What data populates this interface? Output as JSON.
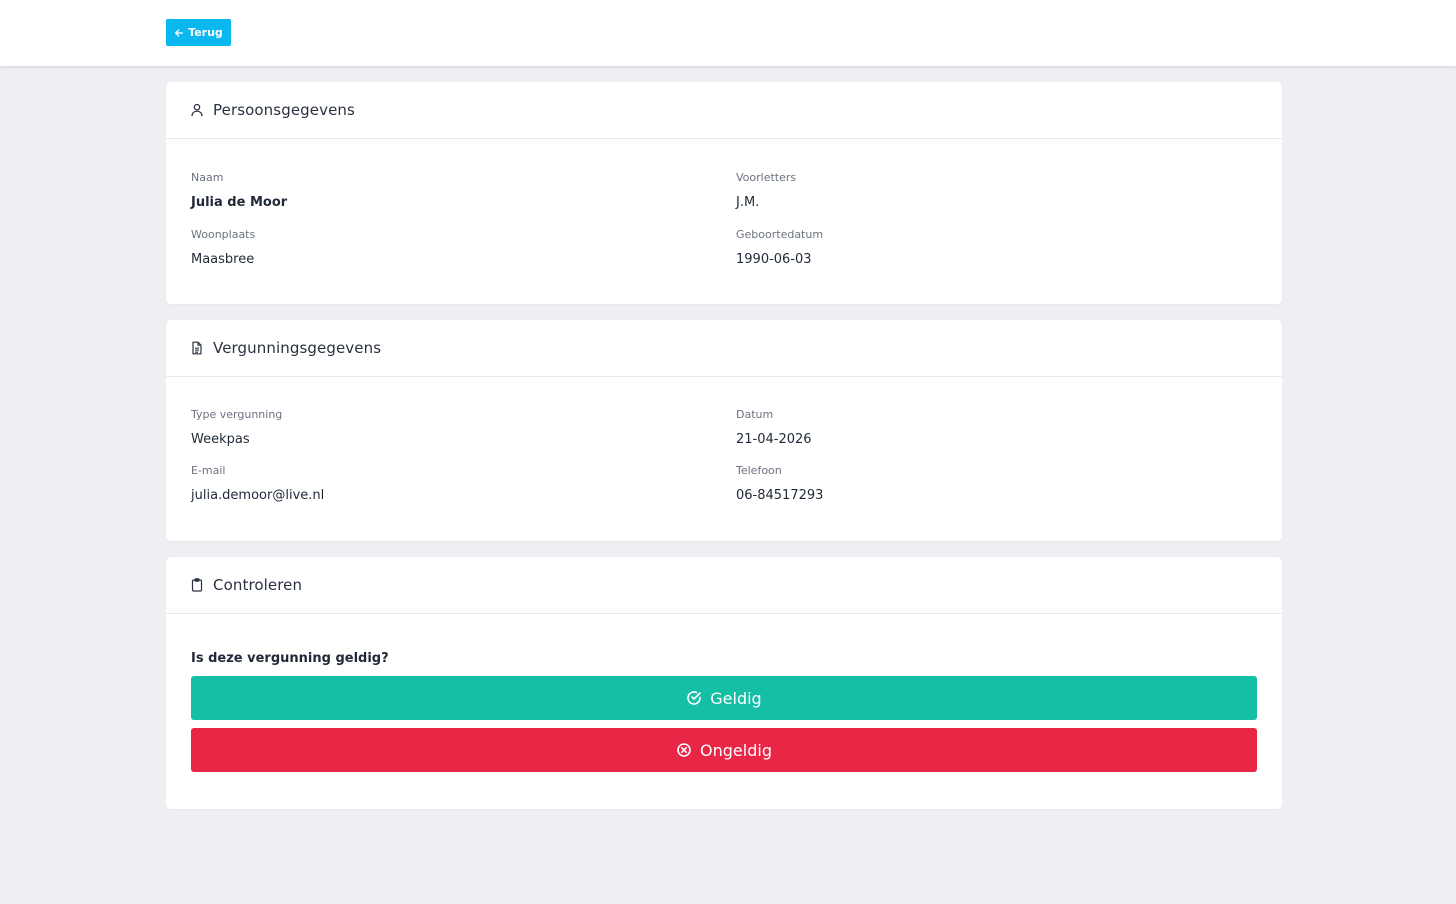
{
  "header": {
    "back_label": "Terug"
  },
  "person": {
    "title": "Persoonsgegevens",
    "name_label": "Naam",
    "name_value": "Julia de Moor",
    "initials_label": "Voorletters",
    "initials_value": "J.M.",
    "city_label": "Woonplaats",
    "city_value": "Maasbree",
    "dob_label": "Geboortedatum",
    "dob_value": "1990-06-03"
  },
  "permit": {
    "title": "Vergunningsgegevens",
    "type_label": "Type vergunning",
    "type_value": "Weekpas",
    "date_label": "Datum",
    "date_value": "21-04-2026",
    "email_label": "E-mail",
    "email_value": "julia.demoor@live.nl",
    "phone_label": "Telefoon",
    "phone_value": "06-84517293"
  },
  "check": {
    "title": "Controleren",
    "question": "Is deze vergunning geldig?",
    "valid_label": "Geldig",
    "invalid_label": "Ongeldig"
  },
  "colors": {
    "accent": "#0ab8f0",
    "valid": "#14bfa6",
    "invalid": "#e92646",
    "background": "#eeeef3"
  },
  "icons": {
    "back": "arrow-left-icon",
    "person": "user-icon",
    "permit": "document-icon",
    "check": "clipboard-icon",
    "valid": "check-circle-icon",
    "invalid": "x-circle-icon"
  }
}
